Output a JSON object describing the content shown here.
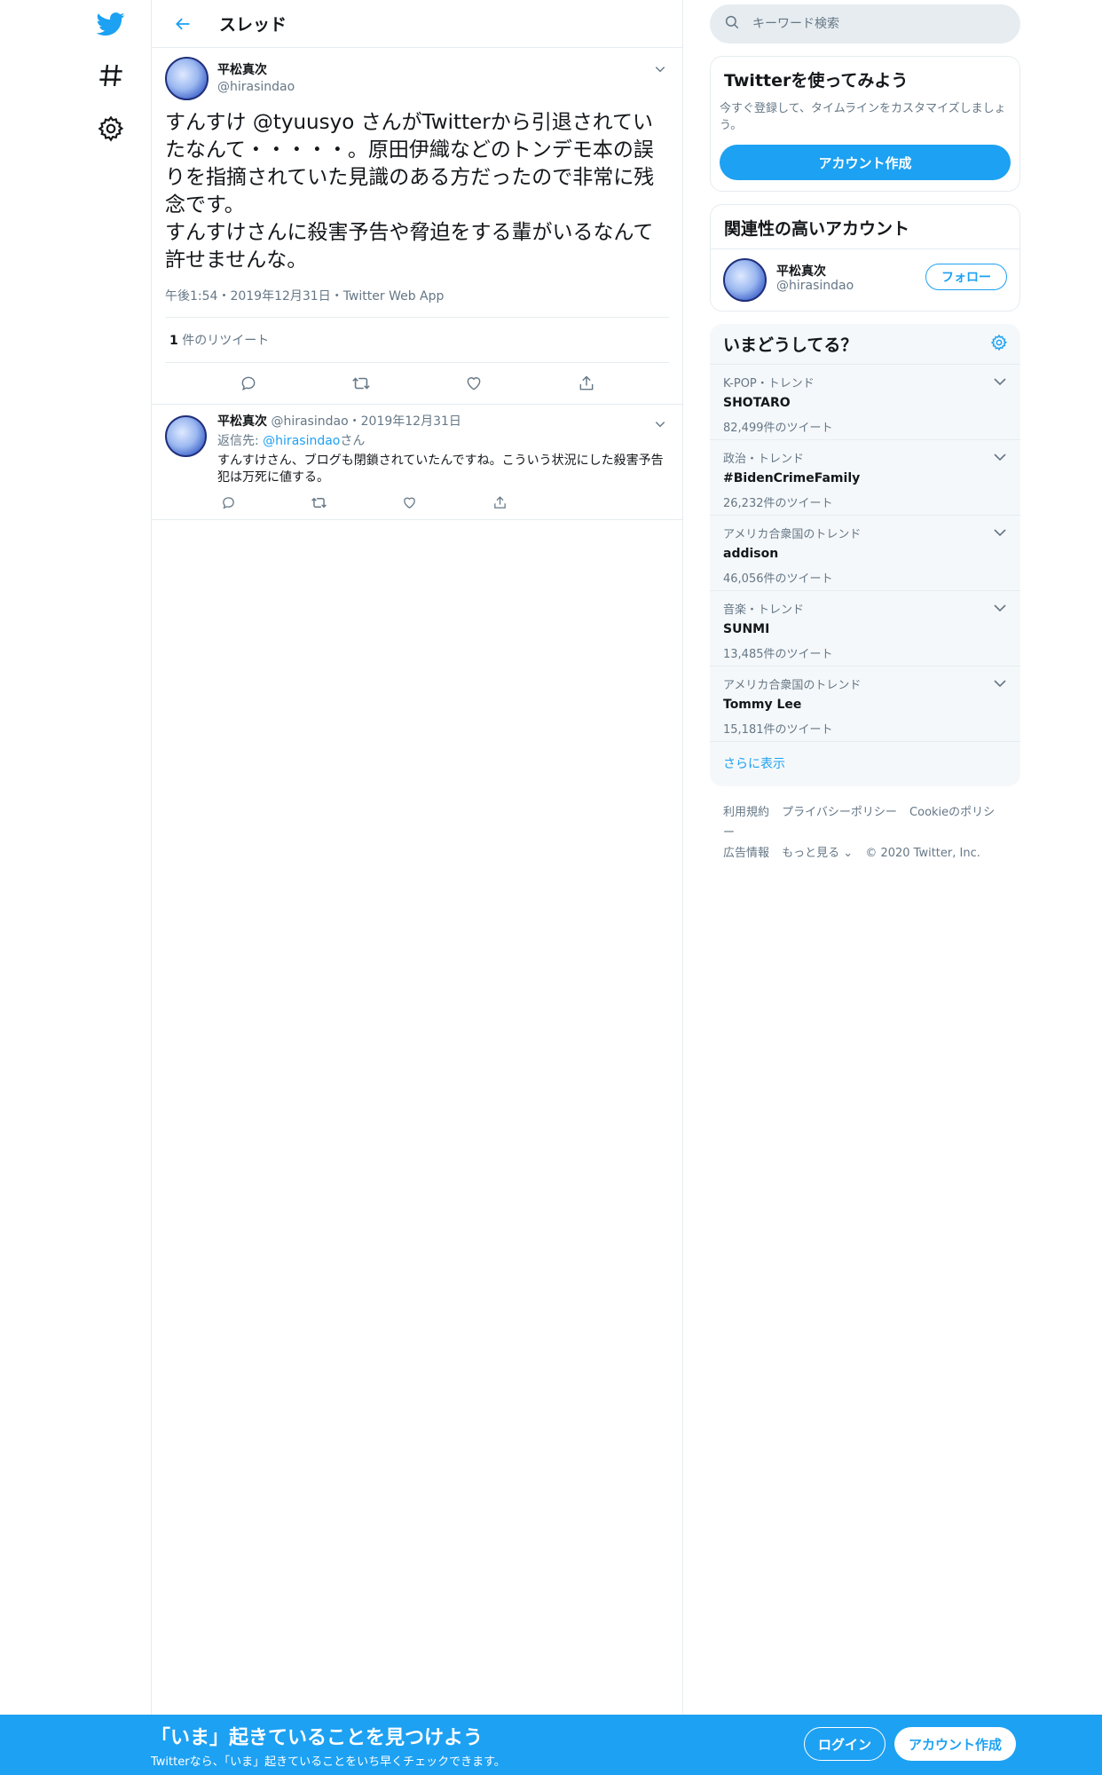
{
  "header": {
    "title": "スレッド"
  },
  "tweet": {
    "author_name": "平松真次",
    "author_handle": "@hirasindao",
    "text_line1": "すんすけ @tyuusyo さんがTwitterから引退されていたなんて・・・・・。原田伊織などのトンデモ本の誤りを指摘されていた見識のある方だったので非常に残念です。",
    "text_line2": "すんすけさんに殺害予告や脅迫をする輩がいるなんて許せませんな。",
    "meta": "午後1:54・2019年12月31日・Twitter Web App",
    "retweet_count": "1",
    "retweet_label": " 件のリツイート"
  },
  "reply": {
    "author_name": "平松真次",
    "author_handle": "@hirasindao",
    "dot": "・",
    "date": "2019年12月31日",
    "reply_to_prefix": "返信先: ",
    "reply_to_handle": "@hirasindao",
    "reply_to_suffix": "さん",
    "text": "すんすけさん、ブログも閉鎖されていたんですね。こういう状況にした殺害予告犯は万死に値する。"
  },
  "search": {
    "placeholder": "キーワード検索"
  },
  "signup_card": {
    "title": "Twitterを使ってみよう",
    "description": "今すぐ登録して、タイムラインをカスタマイズしましょう。",
    "button": "アカウント作成"
  },
  "related": {
    "title": "関連性の高いアカウント",
    "name": "平松真次",
    "handle": "@hirasindao",
    "follow": "フォロー"
  },
  "trends": {
    "title": "いまどうしてる？",
    "items": [
      {
        "context": "K-POP・トレンド",
        "name": "SHOTARO",
        "count": "82,499件のツイート"
      },
      {
        "context": "政治・トレンド",
        "name": "#BidenCrimeFamily",
        "count": "26,232件のツイート"
      },
      {
        "context": "アメリカ合衆国のトレンド",
        "name": "addison",
        "count": "46,056件のツイート"
      },
      {
        "context": "音楽・トレンド",
        "name": "SUNMI",
        "count": "13,485件のツイート"
      },
      {
        "context": "アメリカ合衆国のトレンド",
        "name": "Tommy Lee",
        "count": "15,181件のツイート"
      }
    ],
    "more": "さらに表示"
  },
  "footer": {
    "terms": "利用規約",
    "privacy": "プライバシーポリシー",
    "cookie": "Cookieのポリシー",
    "ads": "広告情報",
    "more": "もっと見る ⌄",
    "copyright": "© 2020 Twitter, Inc."
  },
  "bottombar": {
    "title": "「いま」起きていることを見つけよう",
    "subtitle": "Twitterなら、「いま」起きていることをいち早くチェックできます。",
    "login": "ログイン",
    "signup": "アカウント作成"
  },
  "colors": {
    "accent": "#1da1f2",
    "text": "#14171a",
    "muted": "#657786",
    "border": "#e6ecf0"
  }
}
